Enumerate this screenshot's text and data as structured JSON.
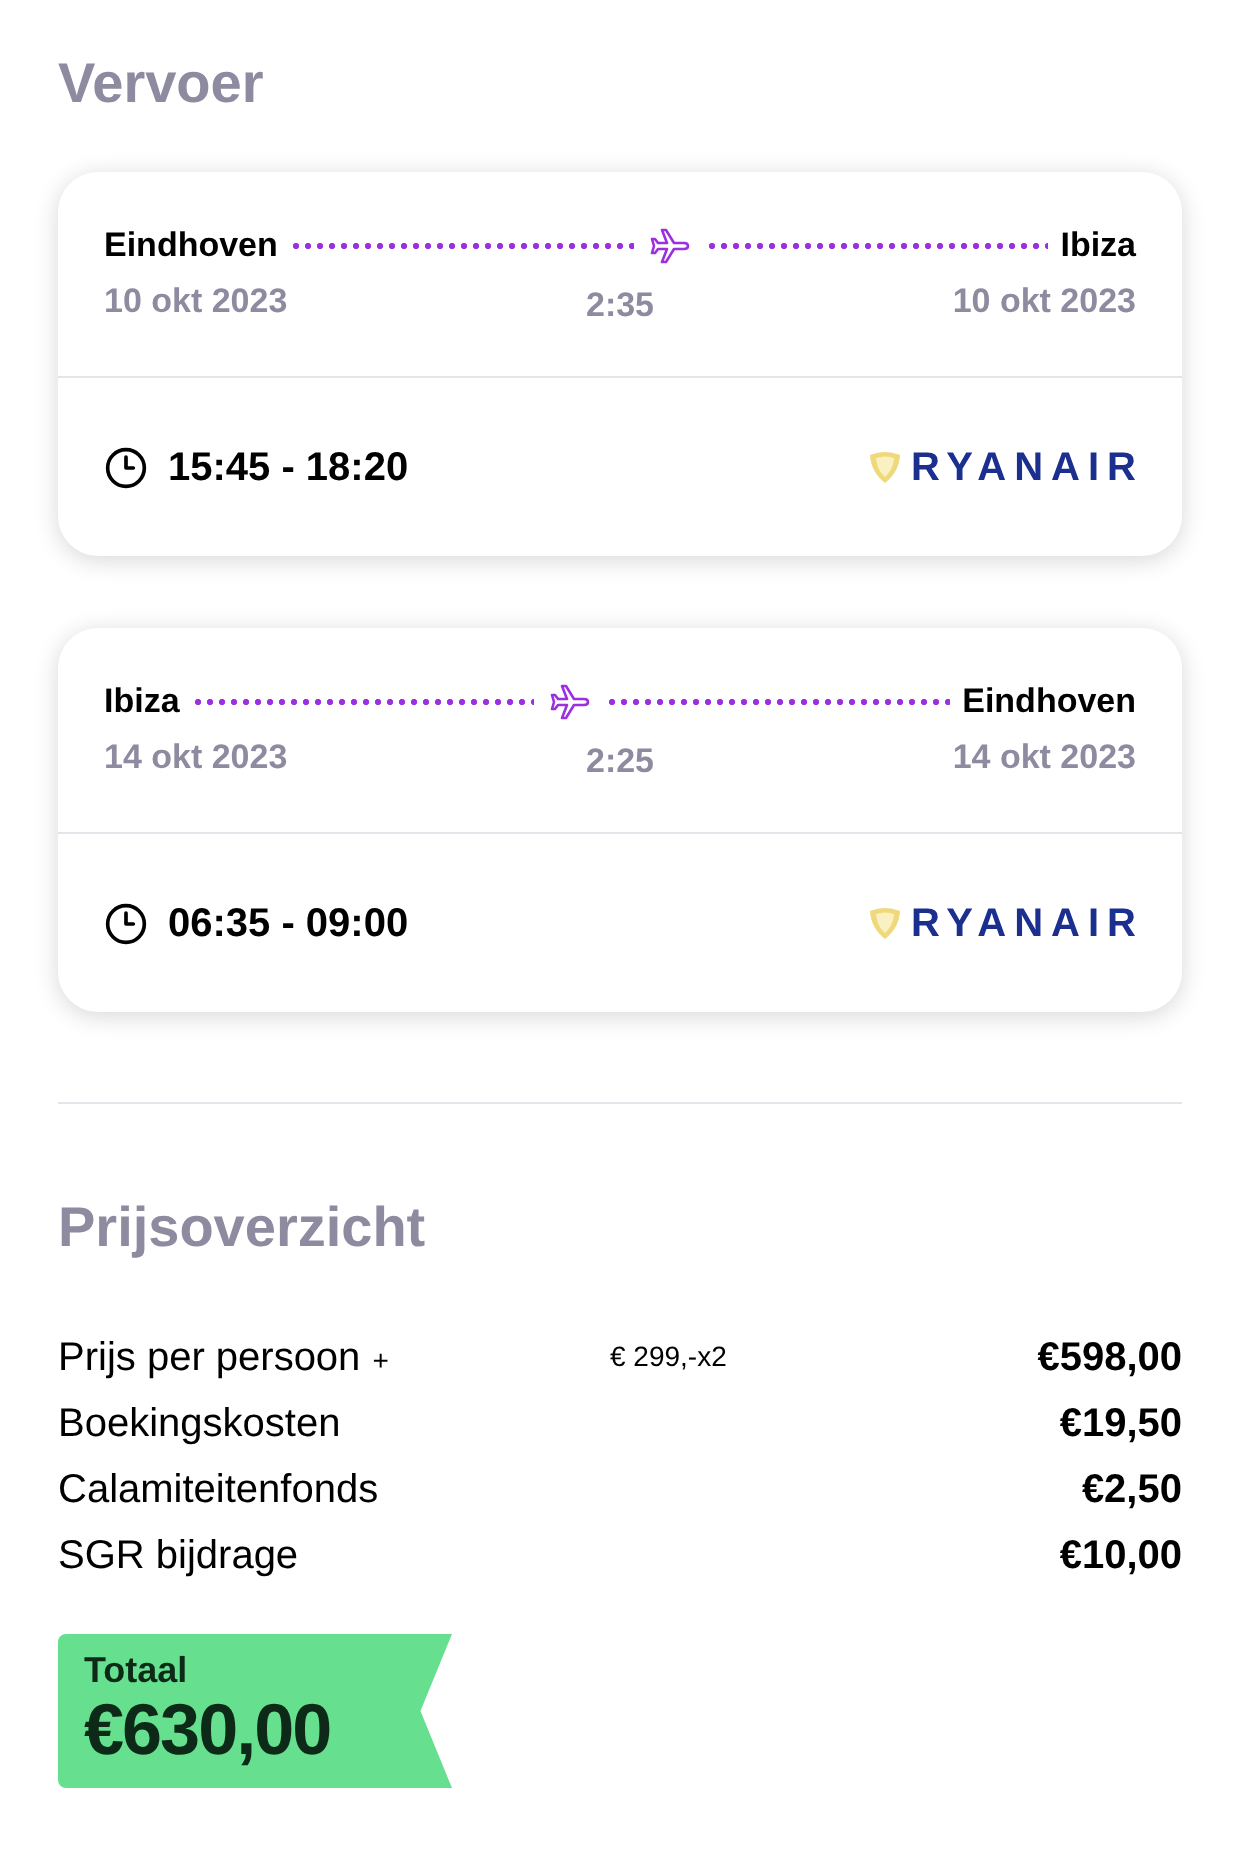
{
  "transport": {
    "title": "Vervoer",
    "flights": [
      {
        "origin": "Eindhoven",
        "destination": "Ibiza",
        "departure_date": "10 okt 2023",
        "arrival_date": "10 okt 2023",
        "duration": "2:35",
        "times": "15:45 - 18:20",
        "carrier": "RYANAIR"
      },
      {
        "origin": "Ibiza",
        "destination": "Eindhoven",
        "departure_date": "14 okt 2023",
        "arrival_date": "14 okt 2023",
        "duration": "2:25",
        "times": "06:35 - 09:00",
        "carrier": "RYANAIR"
      }
    ]
  },
  "price_overview": {
    "title": "Prijsoverzicht",
    "rows": [
      {
        "label": "Prijs per persoon",
        "suffix": "+",
        "note": "€ 299,-x2",
        "amount": "€598,00"
      },
      {
        "label": "Boekingskosten",
        "amount": "€19,50"
      },
      {
        "label": "Calamiteitenfonds",
        "amount": "€2,50"
      },
      {
        "label": "SGR bijdrage",
        "amount": "€10,00"
      }
    ],
    "total": {
      "label": "Totaal",
      "amount": "€630,00"
    }
  }
}
